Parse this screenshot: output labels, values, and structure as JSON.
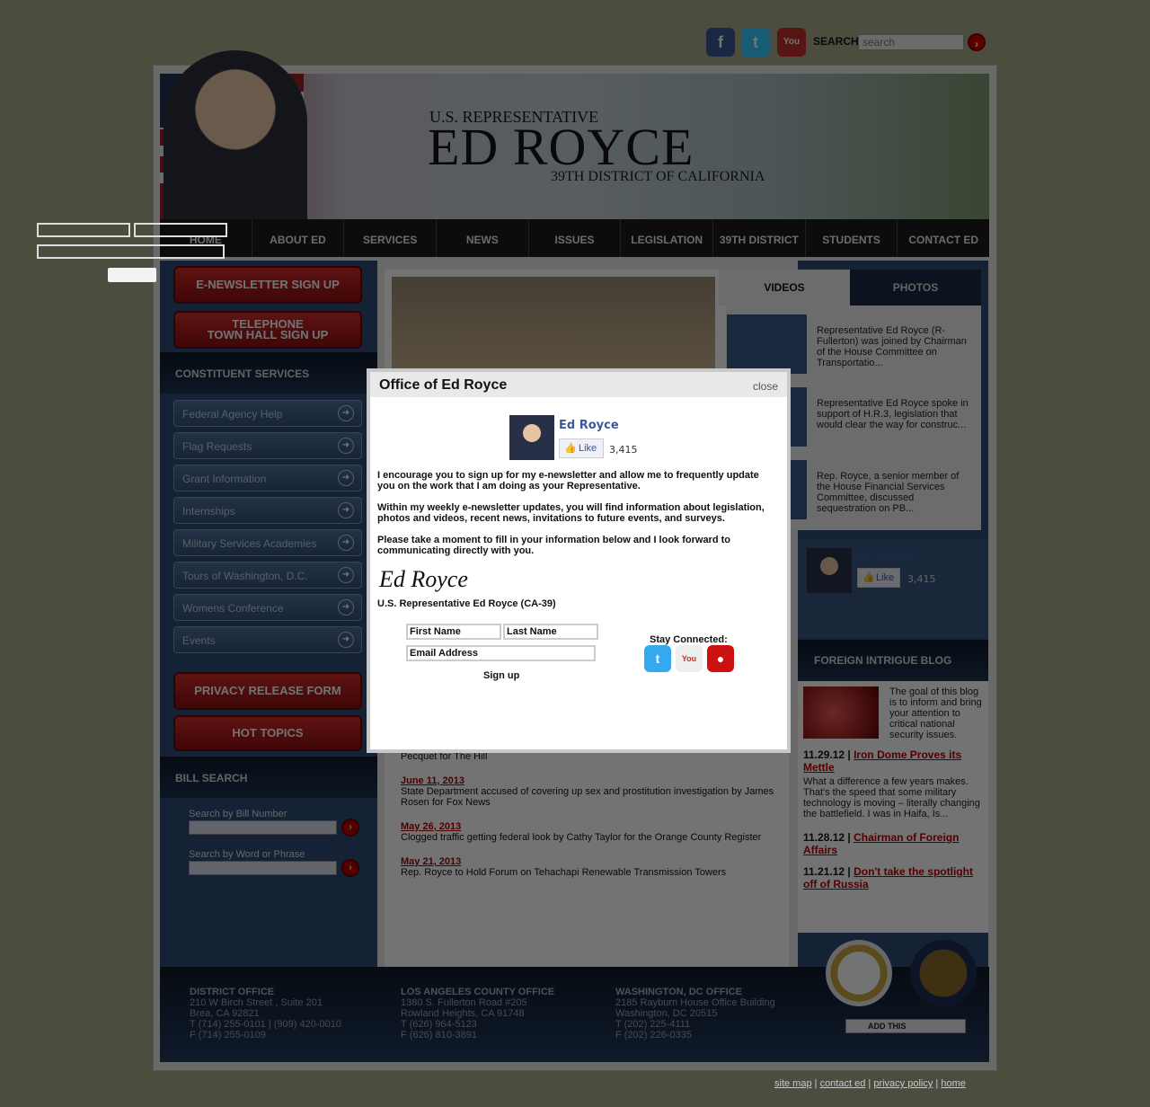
{
  "header": {
    "social": [
      "facebook-icon",
      "twitter-icon",
      "youtube-icon"
    ],
    "search_label": "SEARCH",
    "search_placeholder": "search"
  },
  "banner": {
    "title": "U.S. REPRESENTATIVE",
    "name": "ED ROYCE",
    "district": "39TH DISTRICT OF CALIFORNIA"
  },
  "nav": [
    "HOME",
    "ABOUT ED",
    "SERVICES",
    "NEWS",
    "ISSUES",
    "LEGISLATION",
    "39TH DISTRICT",
    "STUDENTS",
    "CONTACT ED"
  ],
  "left": {
    "enewsletter": "E-NEWSLETTER SIGN UP",
    "telephone": "TELEPHONE\nTOWN HALL SIGN UP",
    "constituent_services": "CONSTITUENT SERVICES",
    "services": [
      "Federal Agency Help",
      "Flag Requests",
      "Grant Information",
      "Internships",
      "Military Services Academies",
      "Tours of Washington, D.C.",
      "Womens Conference",
      "Events"
    ],
    "privacy": "PRIVACY RELEASE FORM",
    "hot_topics": "HOT TOPICS",
    "bill_search": "BILL SEARCH",
    "by_number": "Search by Bill Number",
    "by_word": "Search by Word or Phrase"
  },
  "news": [
    {
      "date": "",
      "text": "Pecquet for The Hill"
    },
    {
      "date": "June 11, 2013",
      "text": "State Department accused of covering up sex and prostitution investigation by James Rosen for Fox News"
    },
    {
      "date": "May 26, 2013",
      "text": "Clogged traffic getting federal look by Cathy Taylor for the Orange County Register"
    },
    {
      "date": "May 21, 2013",
      "text": "Rep. Royce to Hold Forum on Tehachapi Renewable Transmission Towers"
    }
  ],
  "media": {
    "tab_videos": "VIDEOS",
    "tab_photos": "PHOTOS",
    "videos": [
      "Representative Ed Royce (R-Fullerton) was joined by Chairman of the House Committee on Transportatio...",
      "Representative Ed Royce spoke in support of H.R.3, legislation that would clear the way for construc...",
      "Rep. Royce, a senior member of the House Financial Services Committee, discussed sequestration on PB..."
    ]
  },
  "fb": {
    "name": "Ed Royce",
    "like": "Like",
    "count": "3,415"
  },
  "blog": {
    "title": "FOREIGN INTRIGUE BLOG",
    "intro": "The goal of this blog is to inform and bring your attention to critical national security issues.",
    "posts": [
      {
        "date": "11.29.12 |",
        "title": "Iron Dome Proves its Mettle",
        "excerpt": "What a difference a few years makes. That's the speed that some military technology is moving – literally changing the battlefield. I was in Haifa, Is..."
      },
      {
        "date": "11.28.12 |",
        "title": "Chairman of Foreign Affairs",
        "excerpt": ""
      },
      {
        "date": "11.21.12 |",
        "title": "Don't take the spotlight off of Russia",
        "excerpt": ""
      }
    ]
  },
  "footer": {
    "offices": [
      {
        "name": "DISTRICT OFFICE",
        "lines": [
          "210 W Birch Street , Suite 201",
          "Brea, CA 92821",
          "T (714) 255-0101 | (909) 420-0010",
          "F (714) 255-0109"
        ]
      },
      {
        "name": "LOS ANGELES COUNTY OFFICE",
        "lines": [
          "1380 S. Fullerton Road #205",
          "Rowland Heights, CA 91748",
          "T (626) 964-5123",
          "F (626) 810-3891"
        ]
      },
      {
        "name": "WASHINGTON, DC OFFICE",
        "lines": [
          "2185 Rayburn House Office Building",
          "Washington, DC 20515",
          "T (202) 225-4111",
          "F (202) 226-0335"
        ]
      }
    ],
    "addthis": "ADD THIS",
    "links": [
      "site map",
      "contact ed",
      "privacy policy",
      "home"
    ]
  },
  "modal": {
    "title": "Office of Ed Royce",
    "close": "close",
    "fb_name": "Ed Royce",
    "fb_like": "Like",
    "fb_count": "3,415",
    "p1": "I encourage you to sign up for my e-newsletter and allow me to frequently update you on the work that I am doing as your Representative.",
    "p2": "Within my weekly e-newsletter updates, you will find information about legislation, photos and videos, recent news, invitations to future events, and surveys.",
    "p3": "Please take a moment to fill in your information below and I look forward to communicating directly with you.",
    "signature": "Ed Royce",
    "signature_line": "U.S. Representative Ed Royce (CA-39)",
    "first_name": "First Name",
    "last_name": "Last Name",
    "email": "Email Address",
    "signup": "Sign up",
    "stay_connected": "Stay Connected:"
  },
  "colors": {
    "accent_red": "#b00000",
    "nav_bg": "#1b1b1b",
    "panel_blue": "#2f4a73",
    "fb_blue": "#3b5998"
  }
}
